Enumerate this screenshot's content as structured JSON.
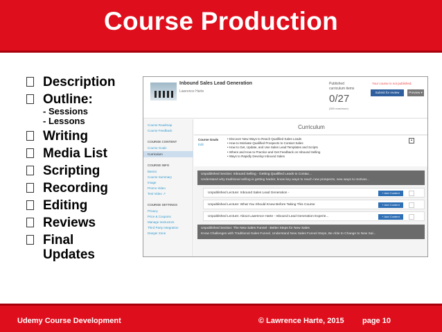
{
  "slide": {
    "title": "Course Production",
    "bullets": [
      {
        "label": "Description"
      },
      {
        "label": "Outline:",
        "sub1": "- Sessions",
        "sub2": "- Lessons"
      },
      {
        "label": "Writing"
      },
      {
        "label": "Media List"
      },
      {
        "label": "Scripting"
      },
      {
        "label": "Recording"
      },
      {
        "label": "Editing"
      },
      {
        "label": "Reviews"
      },
      {
        "label": "Final",
        "sub_line": "Updates"
      }
    ],
    "footer": {
      "left": "Udemy Course Development",
      "center": "© Lawrence Harte, 2015",
      "page": "page 10"
    },
    "colors": {
      "banner": "#df0e1c",
      "text": "#000000"
    }
  },
  "screenshot": {
    "course_title": "Inbound Sales Lead Generation",
    "instructor": "Lawrence Harte",
    "published_label": "Published curriculum items",
    "published_count": "0/27",
    "published_max": "(550 maximum)",
    "not_published": "Your course is not published.",
    "submit_button": "Submit for review",
    "preview_button": "Preview ▾",
    "sidebar": {
      "items_top": [
        "Course Roadmap",
        "Course Feedback"
      ],
      "head_content": "COURSE CONTENT",
      "content_items": [
        "Course Goals",
        "Curriculum"
      ],
      "head_info": "COURSE INFO",
      "info_items": [
        "Basics",
        "Course Summary",
        "Image",
        "Promo Video",
        "Test Video ↗"
      ],
      "head_settings": "COURSE SETTINGS",
      "settings_items": [
        "Privacy",
        "Price & Coupons",
        "Manage Instructors",
        "Third Party Integration",
        "Danger Zone"
      ]
    },
    "curriculum_title": "Curriculum",
    "goals_label": "Course Goals",
    "goals_edit": "Edit",
    "goals": [
      "• Discover New Ways to Reach Qualified Sales Leads",
      "• How to Motivate Qualified Prospects to Contact Sales",
      "• How to Get, Update, and Use Sales Lead Templates and Scripts",
      "• Where and How to Practice and Get Feedback on Inbound Selling",
      "• Ways to Rapidly Develop Inbound Sales"
    ],
    "section1_title": "Unpublished Section: Inbound Selling - Getting Qualified Leads to Contac...",
    "section1_desc": "Understand why traditional selling is getting harder, know key ways to reach new prospects, new ways to motivat...",
    "lectures": [
      "Unpublished Lecture: Inbound Sales Lead Generation -",
      "Unpublished Lecture: What You Should Know Before Taking This Course",
      "Unpublished Lecture: About Lawrence Harte - Inbound Lead Generation Experie..."
    ],
    "add_content": "+ Add Content",
    "section2_title": "Unpublished Section: The New Sales Funnel - Better Steps for New Sales",
    "section2_desc": "Know Challenges with Traditional Sales Funnel, Understand New Sales Funnel Steps, Be Able to Change to New Sal..."
  }
}
